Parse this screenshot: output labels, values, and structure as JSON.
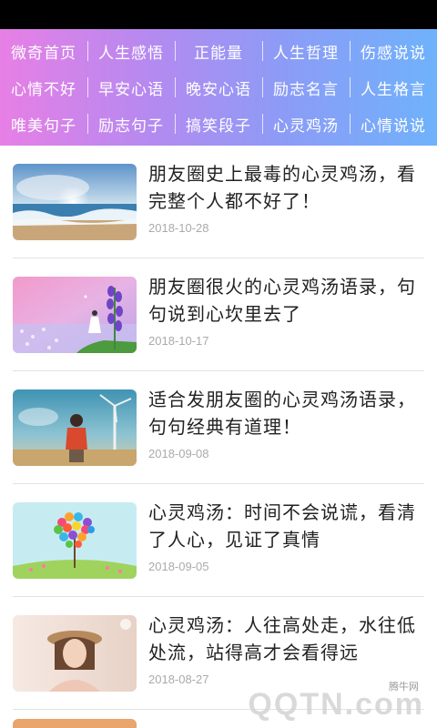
{
  "nav": {
    "items": [
      {
        "label": "微奇首页"
      },
      {
        "label": "人生感悟"
      },
      {
        "label": "正能量"
      },
      {
        "label": "人生哲理"
      },
      {
        "label": "伤感说说"
      },
      {
        "label": "心情不好"
      },
      {
        "label": "早安心语"
      },
      {
        "label": "晚安心语"
      },
      {
        "label": "励志名言"
      },
      {
        "label": "人生格言"
      },
      {
        "label": "唯美句子"
      },
      {
        "label": "励志句子"
      },
      {
        "label": "搞笑段子"
      },
      {
        "label": "心灵鸡汤"
      },
      {
        "label": "心情说说"
      }
    ]
  },
  "articles": [
    {
      "title": "朋友圈史上最毒的心灵鸡汤，看完整个人都不好了！",
      "date": "2018-10-28",
      "image": "sea-sunset"
    },
    {
      "title": "朋友圈很火的心灵鸡汤语录，句句说到心坎里去了",
      "date": "2018-10-17",
      "image": "girl-lavender"
    },
    {
      "title": "适合发朋友圈的心灵鸡汤语录，句句经典有道理！",
      "date": "2018-09-08",
      "image": "girl-windmill"
    },
    {
      "title": "心灵鸡汤：时间不会说谎，看清了人心，见证了真情",
      "date": "2018-09-05",
      "image": "heart-tree"
    },
    {
      "title": "心灵鸡汤：人往高处走，水往低处流，站得高才会看得远",
      "date": "2018-08-27",
      "image": "girl-hat"
    }
  ],
  "watermark": {
    "small": "腾牛网",
    "large": "QQTN.com"
  }
}
